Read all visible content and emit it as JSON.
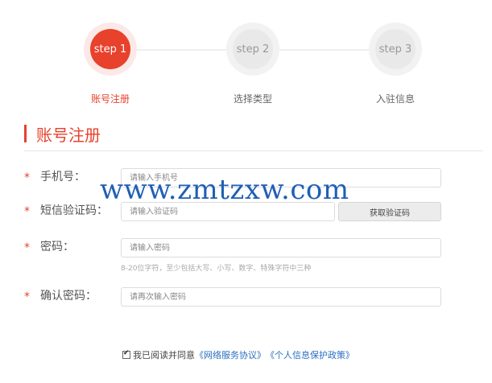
{
  "steps": [
    {
      "badge": "step 1",
      "label": "账号注册"
    },
    {
      "badge": "step 2",
      "label": "选择类型"
    },
    {
      "badge": "step 3",
      "label": "入驻信息"
    }
  ],
  "section": {
    "title": "账号注册"
  },
  "form": {
    "required_mark": "*",
    "phone": {
      "label": "手机号：",
      "placeholder": "请输入手机号"
    },
    "sms": {
      "label": "短信验证码：",
      "placeholder": "请输入验证码",
      "button": "获取验证码"
    },
    "password": {
      "label": "密码：",
      "placeholder": "请输入密码",
      "hint": "8-20位字符，至少包括大写、小写、数字、特殊字符中三种"
    },
    "confirm": {
      "label": "确认密码：",
      "placeholder": "请再次输入密码"
    }
  },
  "agreement": {
    "checked": true,
    "text": "我已阅读并同意",
    "link1": "《网络服务协议》",
    "link2": "《个人信息保护政策》"
  },
  "watermark": "www.zmtzxw.com",
  "colors": {
    "accent": "#e8412c",
    "link": "#2a6fc0"
  }
}
